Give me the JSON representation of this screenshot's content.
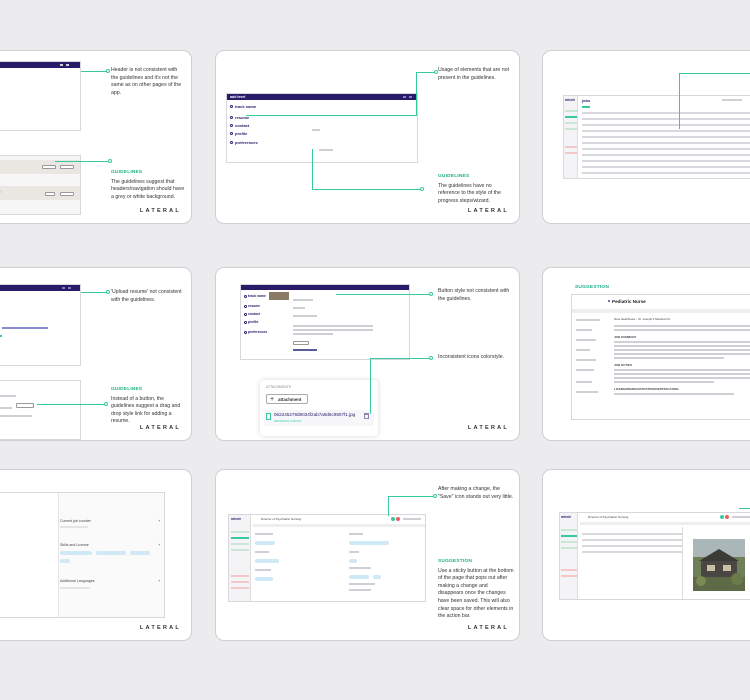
{
  "brand": "LATERAL",
  "colors": {
    "accent": "#39c9a0",
    "header": "#2a1a6a",
    "label": "#1fae86",
    "card_border": "#cfcfd4"
  },
  "cards": {
    "c1": {
      "note1": "Header is not consistent with the guidelines and it's not the same as on other pages of the app.",
      "note2_heading": "GUIDELINES",
      "note2": "The guidelines suggest that headers/navigation should have a grey or white background."
    },
    "c2": {
      "dialog_title": "add level",
      "nav": [
        "track name",
        "resume",
        "contact",
        "profile",
        "preferences"
      ],
      "note1": "Usage of elements that are not present in the guidelines.",
      "note2_heading": "GUIDELINES",
      "note2": "The guidelines have no reference to the style of the progress steps/wizard."
    },
    "c3": {
      "app_name": "mindr",
      "page_title": "jobs"
    },
    "c4": {
      "note1": "'Upload resume' not consistent with the guidelines.",
      "note2_heading": "GUIDELINES",
      "note2": "Instead of a button, the guidelines suggest a drag and drop style link for adding a resume."
    },
    "c5": {
      "nav": [
        "track name",
        "resume",
        "contact",
        "profile",
        "preferences"
      ],
      "attachments_label": "ATTACHMENTS",
      "attachment_button": "attachment",
      "file_name": "062245278d9034f2ab7a9d6c9807f1.jpg",
      "file_meta": "08/29/2019 4:28 PM",
      "note1": "Button style not consistent with the guidelines.",
      "note2": "Inconsistent icons colorstyle."
    },
    "c6": {
      "heading": "SUGGESTION",
      "job_title": "Pediatric Nurse",
      "hospital": "New Healthcare - St. Joseph's Medical Ctr.",
      "section": "JOB SUMMARY",
      "section2": "JOB DUTIES",
      "section3": "LICENSURE/REGISTRATION/CERTIFICATION"
    },
    "c7": {
      "field1": "Current job counter",
      "field2": "Skills and License",
      "field3": "Additional Languages"
    },
    "c8": {
      "app_name": "mindr",
      "page_title": "Director of Psychiatric Nursing",
      "note1": "After making a change, the \"Save\" icon stands out very little.",
      "note2_heading": "SUGGESTION",
      "note2": "Use a sticky button at the bottom of the page that pops out after making a change and disappears once the changes have been saved. This will also clear space for other elements in the action bar."
    },
    "c9": {
      "app_name": "mindr",
      "page_title": "Director of Psychiatric Nursing"
    }
  }
}
